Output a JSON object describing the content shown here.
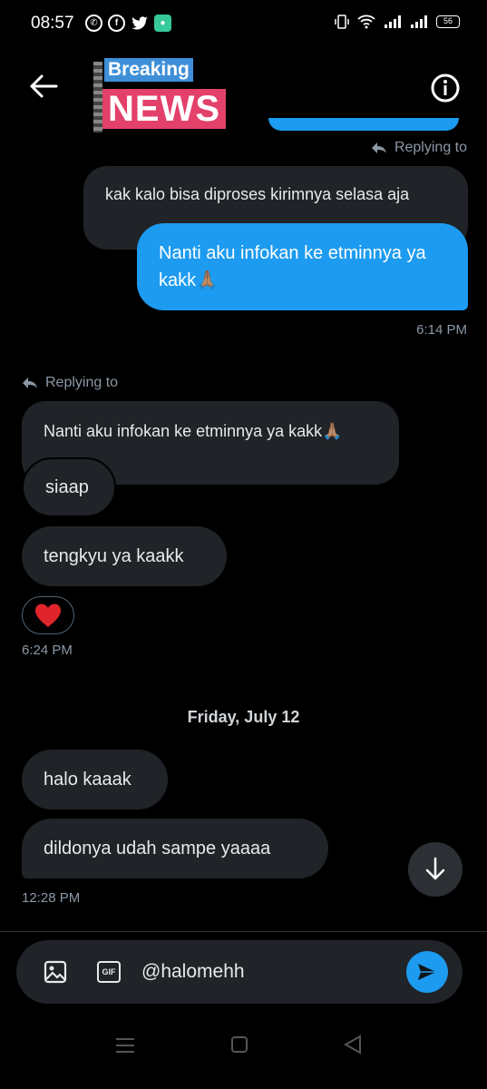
{
  "status_bar": {
    "time": "08:57",
    "battery": "56"
  },
  "header": {
    "banner_top": "Breaking",
    "banner_bottom": "NEWS"
  },
  "messages": {
    "reply_label_1": "Replying to",
    "quoted_1": "kak kalo bisa diproses kirimnya selasa aja",
    "sent_1": "Nanti aku infokan ke etminnya ya kakk🙏🏽",
    "time_1": "6:14 PM",
    "reply_label_2": "Replying to",
    "quoted_2": "Nanti aku infokan ke etminnya ya kakk🙏🏽",
    "recv_1": "siaap",
    "recv_2": "tengkyu ya kaakk",
    "reaction": "❤️",
    "time_2": "6:24 PM",
    "date_divider": "Friday, July 12",
    "recv_3": "halo kaaak",
    "recv_4": "dildonya udah sampe yaaaa",
    "time_3": "12:28 PM"
  },
  "composer": {
    "gif_label": "GIF",
    "input_value": "@halomehh"
  },
  "colors": {
    "accent": "#1d9bf0",
    "bubble_grey": "#202327",
    "background": "#000000"
  }
}
